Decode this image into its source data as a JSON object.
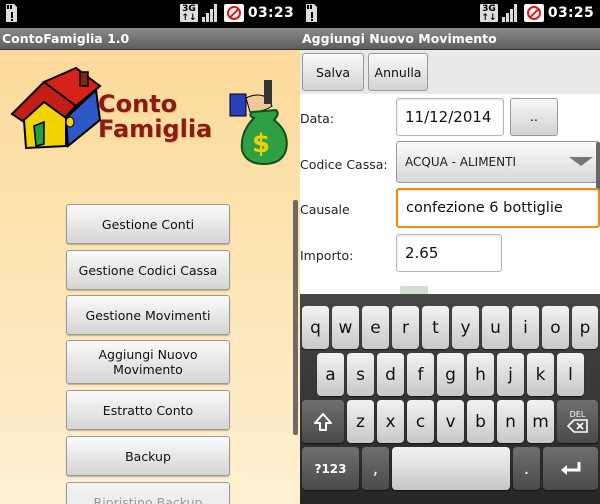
{
  "left": {
    "status": {
      "time": "03:23",
      "net": "3G"
    },
    "title": "ContoFamiglia 1.0",
    "logo": {
      "line1": "Conto",
      "line2": "Famiglia"
    },
    "menu": [
      "Gestione Conti",
      "Gestione Codici Cassa",
      "Gestione Movimenti",
      "Aggiungi Nuovo Movimento",
      "Estratto Conto",
      "Backup",
      "Ripristino Backup"
    ]
  },
  "right": {
    "status": {
      "time": "03:25",
      "net": "3G"
    },
    "title": "Aggiungi Nuovo Movimento",
    "toolbar": {
      "save": "Salva",
      "cancel": "Annulla"
    },
    "form": {
      "date_label": "Data:",
      "date_value": "11/12/2014",
      "date_button": "..",
      "cassa_label": "Codice Cassa:",
      "cassa_value": "ACQUA - ALIMENTI",
      "causale_label": "Causale",
      "causale_value": "confezione 6 bottiglie",
      "importo_label": "Importo:",
      "importo_value": "2.65"
    },
    "keyboard": {
      "row1": [
        "q",
        "w",
        "e",
        "r",
        "t",
        "y",
        "u",
        "i",
        "o",
        "p"
      ],
      "row2": [
        "a",
        "s",
        "d",
        "f",
        "g",
        "h",
        "j",
        "k",
        "l"
      ],
      "row3": [
        "z",
        "x",
        "c",
        "v",
        "b",
        "n",
        "m"
      ],
      "del": "DEL",
      "sym": "?123",
      "comma": ",",
      "period": "."
    }
  },
  "colors": {
    "focus": "#f08a12",
    "logo_text": "#8b1b12",
    "left_bg": "#fde3b0"
  }
}
